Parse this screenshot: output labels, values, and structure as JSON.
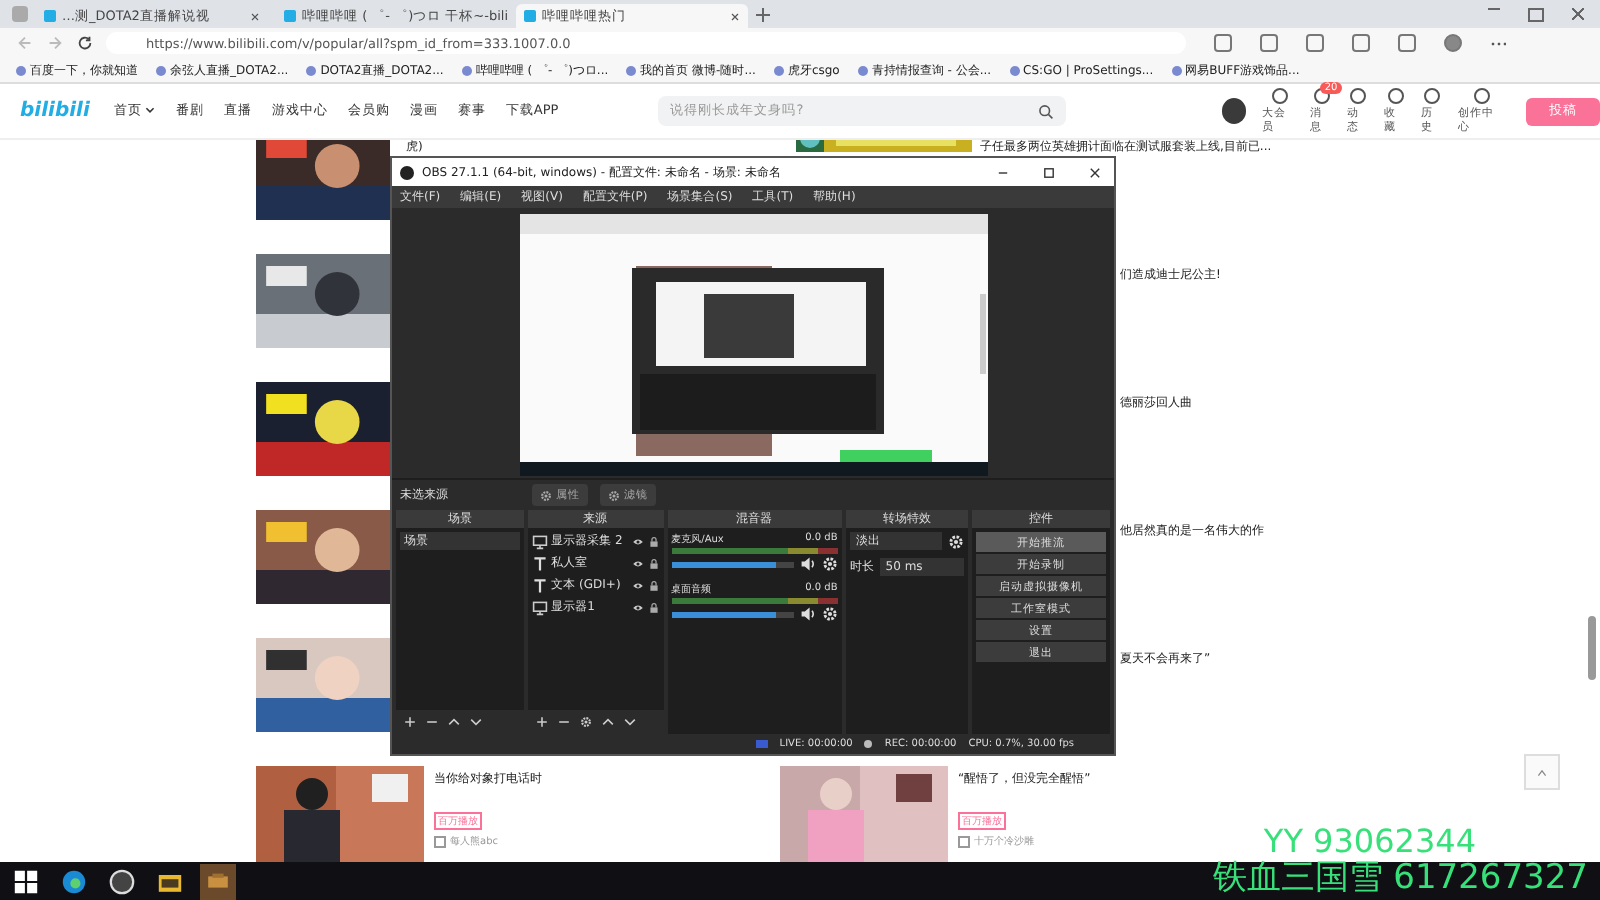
{
  "browser": {
    "tabs": [
      {
        "title": "…测_DOTA2直播解说视",
        "selected": false
      },
      {
        "title": "哔哩哔哩 ( ゜- ゜)つロ 干杯~-bili",
        "selected": false
      },
      {
        "title": "哔哩哔哩热门",
        "selected": true
      }
    ],
    "address": "https://www.bilibili.com/v/popular/all?spm_id_from=333.1007.0.0",
    "bookmarks": [
      "百度一下，你就知道",
      "余弦人直播_DOTA2...",
      "DOTA2直播_DOTA2...",
      "哔哩哔哩 ( ゜- ゜)つロ...",
      "我的首页 微博-随时...",
      "虎牙csgo",
      "青持情报查询 - 公会...",
      "CS:GO | ProSettings...",
      "网易BUFF游戏饰品..."
    ]
  },
  "site": {
    "logo": "bilibili",
    "nav": [
      {
        "label": "首页",
        "caret": true
      },
      {
        "label": "番剧",
        "caret": false
      },
      {
        "label": "直播",
        "caret": false
      },
      {
        "label": "游戏中心",
        "caret": false
      },
      {
        "label": "会员购",
        "caret": false
      },
      {
        "label": "漫画",
        "caret": false
      },
      {
        "label": "赛事",
        "caret": false
      },
      {
        "label": "下载APP",
        "caret": false
      }
    ],
    "search": {
      "placeholder": "说得刚长成年文身吗?"
    },
    "actions": [
      {
        "label": "大会员"
      },
      {
        "label": "消息",
        "badge": "20"
      },
      {
        "label": "动态"
      },
      {
        "label": "收藏"
      },
      {
        "label": "历史"
      },
      {
        "label": "创作中心"
      }
    ],
    "upload": "投稿"
  },
  "feed": [
    {
      "left_title": "虎)",
      "right_title": "子任最多两位英雄拥计面临在测试服套装上线,目前已..."
    },
    {
      "right_title": "们造成迪士尼公主!"
    },
    {
      "right_title": "德丽莎回人曲"
    },
    {
      "right_title": "他居然真的是一名伟大的作"
    },
    {
      "right_title": "夏天不会再来了”"
    }
  ],
  "cards": [
    {
      "title": "当你给对象打电话时",
      "tag": "百万播放",
      "author": "每人熊abc"
    },
    {
      "title": "“醒悟了，但没完全醒悟”",
      "tag": "百万播放",
      "author": "十万个冷沙雕"
    }
  ],
  "obs": {
    "title": "OBS 27.1.1 (64-bit, windows) - 配置文件: 未命名 - 场景: 未命名",
    "menu": [
      "文件(F)",
      "编辑(E)",
      "视图(V)",
      "配置文件(P)",
      "场景集合(S)",
      "工具(T)",
      "帮助(H)"
    ],
    "scene_bar": {
      "label": "未选来源",
      "buttons": [
        "属性",
        "滤镜"
      ]
    },
    "docks": {
      "scenes": {
        "title": "场景",
        "items": [
          "场景"
        ]
      },
      "sources": {
        "title": "来源",
        "items": [
          {
            "name": "显示器采集 2",
            "kind": "display"
          },
          {
            "name": "私人室",
            "kind": "text"
          },
          {
            "name": "文本 (GDI+)",
            "kind": "text"
          },
          {
            "name": "显示器1",
            "kind": "display"
          }
        ]
      },
      "mixer": {
        "title": "混音器",
        "channels": [
          {
            "name": "麦克风/Aux",
            "reading": "0.0 dB",
            "level": 0.85
          },
          {
            "name": "桌面音频",
            "reading": "0.0 dB",
            "level": 0.85
          }
        ]
      },
      "transitions": {
        "title": "转场特效",
        "type": "淡出",
        "duration_label": "时长",
        "duration": "50 ms"
      },
      "controls": {
        "title": "控件",
        "buttons": [
          "开始推流",
          "开始录制",
          "启动虚拟摄像机",
          "工作室模式",
          "设置",
          "退出"
        ]
      }
    },
    "status": {
      "live": "LIVE: 00:00:00",
      "rec": "REC: 00:00:00",
      "cpu": "CPU: 0.7%, 30.00 fps"
    }
  },
  "overlay": [
    "YY 93062344",
    "铁血三国雪 617267327"
  ]
}
